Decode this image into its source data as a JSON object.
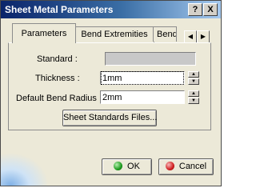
{
  "window": {
    "title": "Sheet Metal Parameters",
    "help_label": "?",
    "close_label": "X"
  },
  "tabs": [
    {
      "label": "Parameters",
      "active": true
    },
    {
      "label": "Bend Extremities",
      "active": false
    },
    {
      "label": "Bend",
      "active": false
    }
  ],
  "tab_scroll": {
    "left": "◀",
    "right": "▶"
  },
  "form": {
    "standard_label": "Standard :",
    "standard_value": "",
    "thickness_label": "Thickness :",
    "thickness_value": "1mm",
    "radius_label": "Default Bend Radius :",
    "radius_value": "2mm",
    "files_button": "Sheet Standards Files..."
  },
  "buttons": {
    "ok": "OK",
    "cancel": "Cancel"
  },
  "colors": {
    "title_gradient_start": "#0a246a",
    "ok_icon": "#1e9a1e",
    "cancel_icon": "#d02020"
  }
}
